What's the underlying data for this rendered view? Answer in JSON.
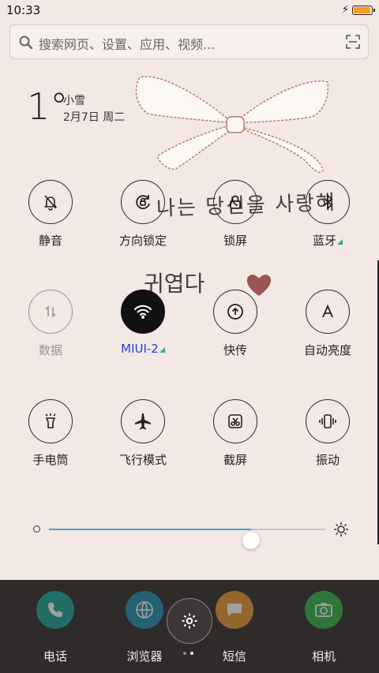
{
  "status": {
    "time": "10:33"
  },
  "search": {
    "placeholder": "搜索网页、设置、应用、视频..."
  },
  "weather": {
    "temp": "1°",
    "condition": "小雪",
    "date": "2月7日 周二"
  },
  "wallpaper": {
    "text1": "나는 당신을 사랑해",
    "text2": "귀엽다"
  },
  "toggles": [
    {
      "label": "静音",
      "icon": "bell-off-icon",
      "state": "off"
    },
    {
      "label": "方向锁定",
      "icon": "rotation-lock-icon",
      "state": "off"
    },
    {
      "label": "锁屏",
      "icon": "lock-icon",
      "state": "off"
    },
    {
      "label": "蓝牙",
      "icon": "bluetooth-icon",
      "state": "off"
    },
    {
      "label": "数据",
      "icon": "data-arrows-icon",
      "state": "disabled"
    },
    {
      "label": "MIUI-2",
      "icon": "wifi-icon",
      "state": "on"
    },
    {
      "label": "快传",
      "icon": "transfer-icon",
      "state": "off"
    },
    {
      "label": "自动亮度",
      "icon": "auto-brightness-icon",
      "state": "off"
    },
    {
      "label": "手电筒",
      "icon": "flashlight-icon",
      "state": "off"
    },
    {
      "label": "飞行模式",
      "icon": "airplane-icon",
      "state": "off"
    },
    {
      "label": "截屏",
      "icon": "screenshot-icon",
      "state": "off"
    },
    {
      "label": "振动",
      "icon": "vibrate-icon",
      "state": "off"
    }
  ],
  "brightness": {
    "level": 0.73
  },
  "dock": [
    {
      "label": "电话",
      "icon": "phone-icon",
      "color": "#1aa69a"
    },
    {
      "label": "浏览器",
      "icon": "browser-icon",
      "color": "#1f8fb0"
    },
    {
      "label": "短信",
      "icon": "sms-icon",
      "color": "#e9982f"
    },
    {
      "label": "相机",
      "icon": "camera-icon",
      "color": "#33b34a"
    }
  ],
  "colors": {
    "accent": "#1f3fd6",
    "slider": "#4f9fd1",
    "wifi_bg": "#111111"
  }
}
